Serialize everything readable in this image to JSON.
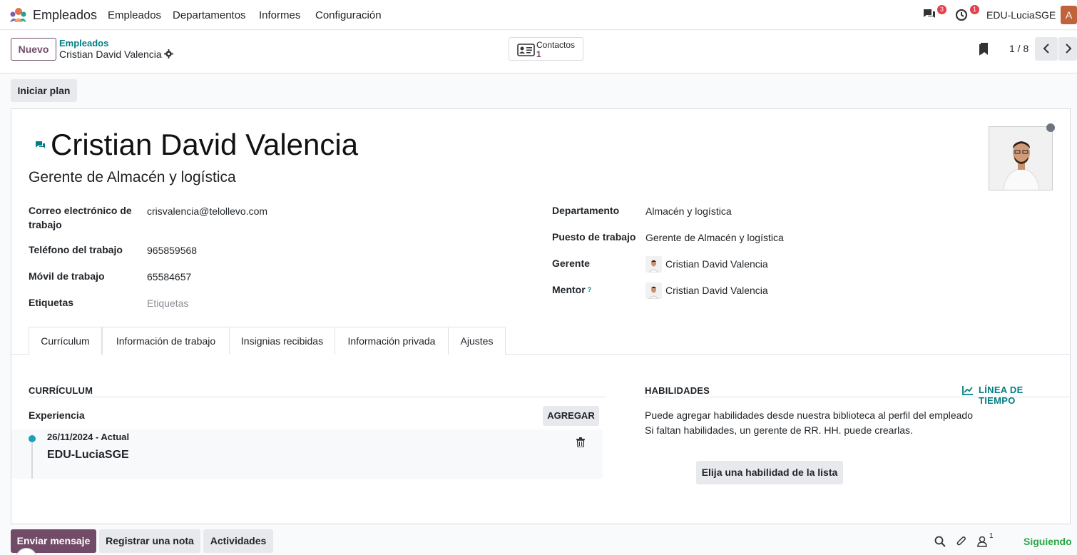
{
  "navbar": {
    "app_name": "Empleados",
    "menu": [
      "Empleados",
      "Departamentos",
      "Informes",
      "Configuración"
    ],
    "messages_badge": "3",
    "activities_badge": "1",
    "company": "EDU-LuciaSGE",
    "user_initial": "A"
  },
  "control": {
    "new_label": "Nuevo",
    "breadcrumb_parent": "Empleados",
    "breadcrumb_current": "Cristian David Valencia",
    "contacts_label": "Contactos",
    "contacts_count": "1",
    "pager": "1 / 8"
  },
  "actions": {
    "start_plan": "Iniciar plan"
  },
  "employee": {
    "name": "Cristian David Valencia",
    "job_title": "Gerente de Almacén y logística",
    "left_fields": [
      {
        "label": "Correo electrónico de trabajo",
        "value": "crisvalencia@telollevo.com"
      },
      {
        "label": "Teléfono del trabajo",
        "value": "965859568"
      },
      {
        "label": "Móvil de trabajo",
        "value": "65584657"
      },
      {
        "label": "Etiquetas",
        "value": "Etiquetas"
      }
    ],
    "right_fields": [
      {
        "label": "Departamento",
        "value": "Almacén y logística"
      },
      {
        "label": "Puesto de trabajo",
        "value": "Gerente de Almacén y logística"
      },
      {
        "label": "Gerente",
        "value": "Cristian David Valencia"
      },
      {
        "label": "Mentor",
        "value": "Cristian David Valencia",
        "help": "?"
      }
    ]
  },
  "tabs": [
    "Currículum",
    "Información de trabajo",
    "Insignias recibidas",
    "Información privada",
    "Ajustes"
  ],
  "resume": {
    "title": "CURRÍCULUM",
    "experience_label": "Experiencia",
    "add_label": "AGREGAR",
    "entry_date": "26/11/2024 - Actual",
    "entry_name": "EDU-LuciaSGE"
  },
  "skills": {
    "title": "HABILIDADES",
    "timeline_label": "LÍNEA DE TIEMPO",
    "text_line1": "Puede agregar habilidades desde nuestra biblioteca al perfil del empleado",
    "text_line2": "Si faltan habilidades, un gerente de RR. HH. puede crearlas.",
    "pick_label": "Elija una habilidad de la lista"
  },
  "chatter": {
    "send_message": "Enviar mensaje",
    "log_note": "Registrar una nota",
    "activities": "Actividades",
    "followers_count": "1",
    "following": "Siguiendo"
  },
  "colors": {
    "primary": "#714b67",
    "teal": "#017e84",
    "badge": "#e0414c",
    "following": "#28a745"
  }
}
